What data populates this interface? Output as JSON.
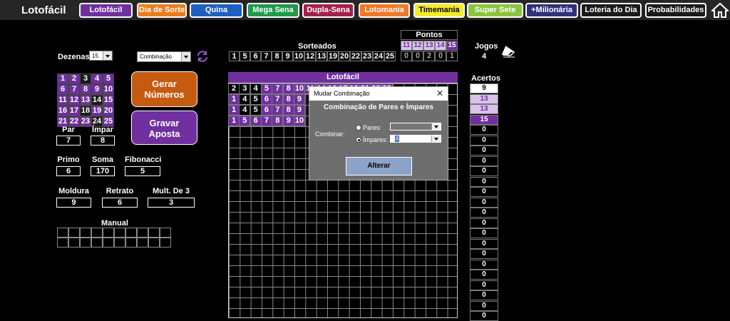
{
  "app": {
    "title": "Lotofácil"
  },
  "menu": [
    {
      "label": "Lotofácil",
      "bg": "#7030a0"
    },
    {
      "label": "Dia de Sorte",
      "bg": "#e87d1e"
    },
    {
      "label": "Quina",
      "bg": "#1f5fbf"
    },
    {
      "label": "Mega Sena",
      "bg": "#1e9a4a"
    },
    {
      "label": "Dupla-Sena",
      "bg": "#a3204a"
    },
    {
      "label": "Lotomania",
      "bg": "#f07828"
    },
    {
      "label": "Timemania",
      "bg": "#f2ec2a",
      "fg": "#000"
    },
    {
      "label": "Super Sete",
      "bg": "#8bc53f"
    },
    {
      "label": "+Milionária",
      "bg": "#30307a"
    },
    {
      "label": "Loteria do Dia",
      "bg": "#1a1a1a"
    },
    {
      "label": "Probabilidades",
      "bg": "#1a1a1a"
    }
  ],
  "controls": {
    "dezenas_label": "Dezenas",
    "dezenas_value": "15",
    "combinacao_value": "Combinação"
  },
  "sorteados": {
    "label": "Sorteados",
    "numbers": [
      "1",
      "5",
      "6",
      "7",
      "8",
      "9",
      "10",
      "12",
      "13",
      "19",
      "20",
      "22",
      "23",
      "24",
      "25"
    ]
  },
  "pontos": {
    "label": "Pontos",
    "headers": [
      "11",
      "12",
      "13",
      "14",
      "15"
    ],
    "values": [
      "0",
      "0",
      "2",
      "0",
      "1"
    ]
  },
  "jogos": {
    "label": "Jogos",
    "value": "4"
  },
  "number_grid": {
    "rows": [
      [
        "1",
        "2",
        "3",
        "4",
        "5"
      ],
      [
        "6",
        "7",
        "8",
        "9",
        "10"
      ],
      [
        "11",
        "12",
        "13",
        "14",
        "15"
      ],
      [
        "16",
        "17",
        "18",
        "19",
        "20"
      ],
      [
        "21",
        "22",
        "23",
        "24",
        "25"
      ]
    ],
    "dark": [
      "3",
      "14",
      "18",
      "24"
    ]
  },
  "buttons": {
    "gerar": [
      "Gerar",
      "Números"
    ],
    "gravar": [
      "Gravar",
      "Aposta"
    ]
  },
  "stats": {
    "par": {
      "label": "Par",
      "value": "7"
    },
    "impar": {
      "label": "Ímpar",
      "value": "8"
    },
    "primo": {
      "label": "Primo",
      "value": "6"
    },
    "soma": {
      "label": "Soma",
      "value": "170"
    },
    "fibonacci": {
      "label": "Fibonacci",
      "value": "5"
    },
    "moldura": {
      "label": "Moldura",
      "value": "9"
    },
    "retrato": {
      "label": "Retrato",
      "value": "6"
    },
    "mult3": {
      "label": "Mult. De 3",
      "value": "3"
    }
  },
  "manual": {
    "label": "Manual"
  },
  "games_table": {
    "header": "Lotofácil",
    "rows": [
      [
        "2",
        "3",
        "4",
        "5",
        "7",
        "8",
        "10",
        "11",
        "14",
        "16",
        "17",
        "19",
        "21",
        "22",
        "23"
      ],
      [
        "1",
        "4",
        "5",
        "6",
        "7",
        "8",
        "9"
      ],
      [
        "1",
        "4",
        "5",
        "6",
        "7",
        "8",
        "9"
      ],
      [
        "1",
        "5",
        "6",
        "7",
        "8",
        "9",
        "10"
      ]
    ]
  },
  "acertos": {
    "label": "Acertos",
    "values": [
      "9",
      "13",
      "13",
      "15",
      "0",
      "0",
      "0",
      "0",
      "0",
      "0",
      "0",
      "0",
      "0",
      "0",
      "0",
      "0",
      "0",
      "0",
      "0",
      "0",
      "0",
      "0",
      "0"
    ]
  },
  "dialog": {
    "title": "Mudar Combinação",
    "close": "✕",
    "heading": "Combinação de Pares e Ímpares",
    "combinar_label": "Combinar:",
    "pares_label": "Pares:",
    "impares_label": "Ímpares:",
    "impares_value": "8",
    "alterar_label": "Alterar"
  }
}
